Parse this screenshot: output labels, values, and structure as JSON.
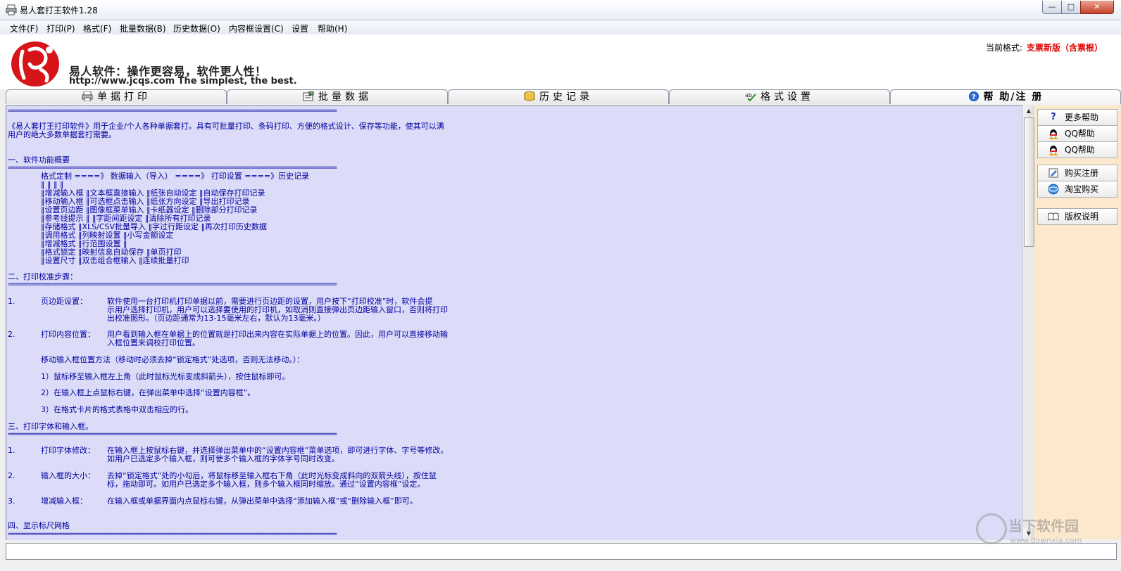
{
  "window": {
    "title": "易人套打王软件1.28",
    "controls": {
      "minimize": "—",
      "maximize": "□",
      "close": "✕"
    }
  },
  "menu": [
    "文件(F)",
    "打印(P)",
    "格式(F)",
    "批量数据(B)",
    "历史数据(O)",
    "内容框设置(C)",
    "设置",
    "帮助(H)"
  ],
  "banner": {
    "slogan": "易人软件：操作更容易，软件更人性！",
    "url_line": "http://www.jcqs.com  The simplest, the best.",
    "current_format_label": "当前格式:",
    "current_format_value": "支票新版（含票根）"
  },
  "tabs": [
    {
      "label": "单据打印",
      "icon": "printer-icon"
    },
    {
      "label": "批量数据",
      "icon": "batch-data-icon"
    },
    {
      "label": "历史记录",
      "icon": "database-icon"
    },
    {
      "label": "格式设置",
      "icon": "spellcheck-icon"
    },
    {
      "label": "帮 助/注 册",
      "icon": "help-icon",
      "active": true
    }
  ],
  "right_panel": [
    {
      "label": "更多帮助",
      "icon": "question-icon"
    },
    {
      "label": "QQ帮助",
      "icon": "qq-penguin-icon"
    },
    {
      "label": "QQ帮助",
      "icon": "qq-penguin-icon"
    },
    {
      "label": "购买注册",
      "icon": "register-icon"
    },
    {
      "label": "淘宝购买",
      "icon": "taobao-icon"
    },
    {
      "label": "版权说明",
      "icon": "book-icon"
    }
  ],
  "content": {
    "divider": "=======================================================================================================================",
    "intro1": "《易人套打王打印软件》用于企业/个人各种单据套打。具有可批量打印、条码打印、方便的格式设计、保存等功能，使其可以满",
    "intro2": "用户的绝大多数单据套打需要。",
    "s1_title": "一、软件功能概要",
    "s1_header": "格式定制 ====》 数据输入（导入） ====》 打印设置  ====》历史记录",
    "s1_rows": [
      "‖                ‖                       ‖                    ‖",
      "‖增减输入框       ‖文本框直接输入          ‖纸张自动设定          ‖自动保存打印记录",
      "‖移动输入框       ‖可选框点击输入          ‖纸张方向设定          ‖导出打印记录",
      "‖设置页边距       ‖图像框菜单输入          ‖卡纸器设定            ‖删除部分打印记录",
      "‖参考线提示       ‖                       ‖字距间距设定          ‖清除所有打印记录",
      "‖存储格式         ‖XLS/CSV批量导入         ‖字过行距设定          ‖再次打印历史数据",
      "‖调用格式         ‖列映射设置              ‖小写金额设定",
      "‖增减格式         ‖行范围设置              ‖",
      "‖格式锁定         ‖映射信息自动保存         ‖单页打印",
      "‖设置尺寸         ‖双击组合框输入           ‖连续批量打印"
    ],
    "s2_title": "二、打印校准步骤：",
    "s2_1_num": "1.",
    "s2_1_label": "页边距设置：",
    "s2_1_lines": [
      "软件使用一台打印机打印单据以前，需要进行页边距的设置，用户按下“打印校准”时，软件会提",
      "示用户选择打印机，用户可以选择要使用的打印机，如取消则直接弹出页边距输入窗口，否则将打印",
      "出校准图形。（页边距通常为13-15毫米左右，默认为13毫米。）"
    ],
    "s2_2_num": "2.",
    "s2_2_label": "打印内容位置：",
    "s2_2_lines": [
      "用户看到输入框在单据上的位置就是打印出来内容在实际单据上的位置。因此，用户可以直接移动输",
      "入框位置来调校打印位置。"
    ],
    "s2_move": "移动输入框位置方法（移动时必须去掉“锁定格式”处选项，否则无法移动。）：",
    "s2_steps": [
      "1）鼠标移至输入框左上角（此时鼠标光标变成斜箭头），按住鼠标即可。",
      "2）在输入框上点鼠标右键，在弹出菜单中选择“设置内容框”。",
      "3）在格式卡片的格式表格中双击相应的行。"
    ],
    "s3_title": "三、打印字体和输入框。",
    "s3_1_num": "1.",
    "s3_1_label": "打印字体修改：",
    "s3_1_lines": [
      "在输入框上按鼠标右键，并选择弹出菜单中的“设置内容框”菜单选项，即可进行字体、字号等修改。",
      "如用户已选定多个输入框，则可使多个输入框的字体字号同时改变。"
    ],
    "s3_2_num": "2.",
    "s3_2_label": "输入框的大小：",
    "s3_2_lines": [
      "去掉“锁定格式”处的小勾后，将鼠标移至输入框右下角（此时光标变成斜向的双箭头线），按住鼠",
      "标，拖动即可。如用户已选定多个输入框，则多个输入框同时缩放。通过“设置内容框”设定。"
    ],
    "s3_3_num": "3.",
    "s3_3_label": "增减输入框：",
    "s3_3_lines": [
      "在输入框或单据界面内点鼠标右键，从弹出菜单中选择“添加输入框”或“删除输入框”即可。"
    ],
    "s4_title": "四、显示标尺网格"
  },
  "watermark": {
    "main": "当下软件园",
    "sub": "www.downxia.com"
  },
  "colors": {
    "content_bg": "#dcdcf8",
    "text": "#0000a0",
    "right_panel_bg": "#fce8cc",
    "format_value": "#e00000"
  }
}
